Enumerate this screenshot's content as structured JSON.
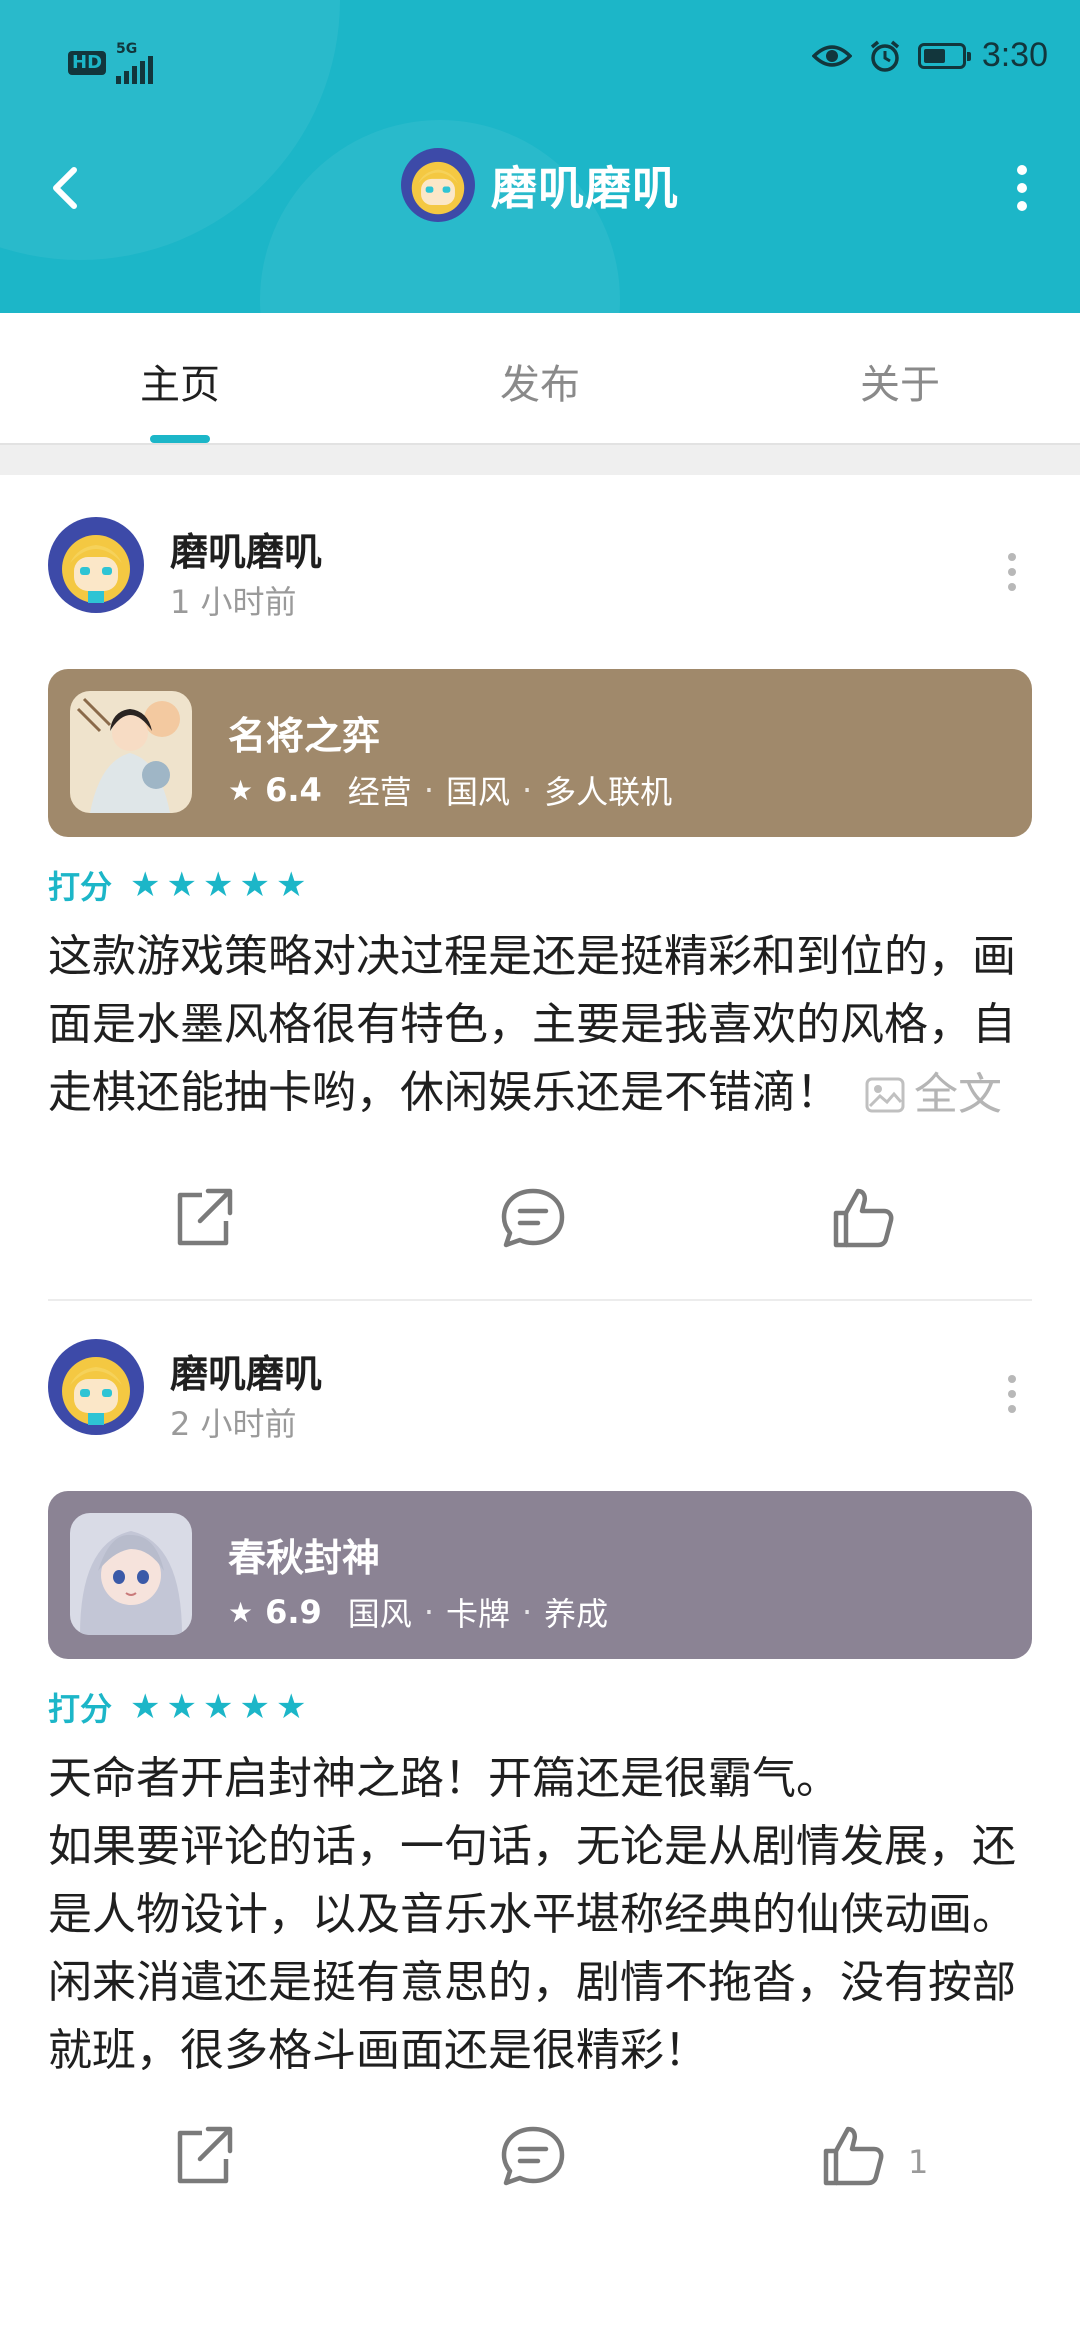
{
  "status_bar": {
    "hd": "HD",
    "network": "5G",
    "time": "3:30"
  },
  "header": {
    "title": "磨叽磨叽",
    "back_icon": "chevron-left-icon",
    "more_icon": "vertical-dots-icon",
    "bg_color": "#1cb6c8"
  },
  "tabs": [
    {
      "label": "主页",
      "active": true
    },
    {
      "label": "发布",
      "active": false
    },
    {
      "label": "关于",
      "active": false
    }
  ],
  "posts": [
    {
      "author": "磨叽磨叽",
      "time": "1 小时前",
      "game": {
        "name": "名将之弈",
        "score": "6.4",
        "tags": [
          "经营",
          "国风",
          "多人联机"
        ],
        "card_color": "#a0896b"
      },
      "rating_label": "打分",
      "stars": 5,
      "body": [
        "这款游戏策略对决过程是还是挺精彩和到位的，画面是水墨风格很有特色，主要是我喜欢的风格，自走棋还能抽卡哟，休闲娱乐还是不错滴！"
      ],
      "full_text_label": "全文",
      "likes": ""
    },
    {
      "author": "磨叽磨叽",
      "time": "2 小时前",
      "game": {
        "name": "春秋封神",
        "score": "6.9",
        "tags": [
          "国风",
          "卡牌",
          "养成"
        ],
        "card_color": "#8b8394"
      },
      "rating_label": "打分",
      "stars": 5,
      "body": [
        "天命者开启封神之路！开篇还是很霸气。",
        "如果要评论的话，一句话，无论是从剧情发展，还是人物设计，以及音乐水平堪称经典的仙侠动画。",
        "闲来消遣还是挺有意思的，剧情不拖沓，没有按部就班，很多格斗画面还是很精彩！"
      ],
      "full_text_label": "",
      "likes": "1"
    }
  ]
}
